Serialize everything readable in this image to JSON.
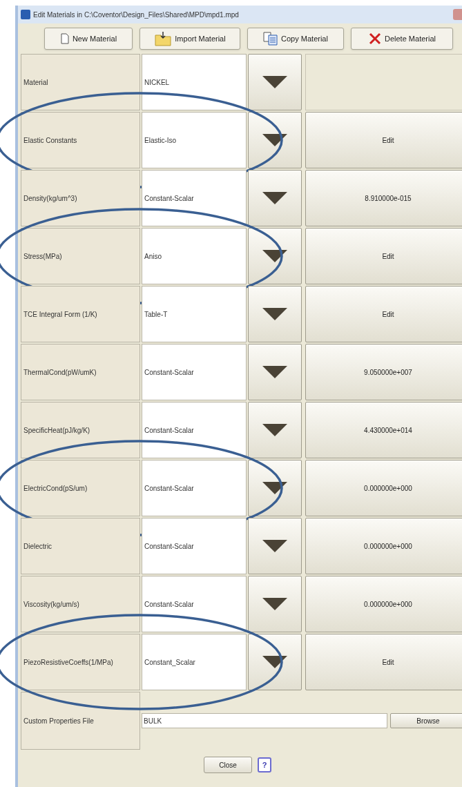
{
  "window": {
    "title": "Edit Materials in C:\\Coventor\\Design_Files\\Shared\\MPD\\mpd1.mpd"
  },
  "toolbar": [
    {
      "label": "New Material",
      "kind": "new"
    },
    {
      "label": "Import Material",
      "kind": "import"
    },
    {
      "label": "Copy Material",
      "kind": "copy"
    },
    {
      "label": "Delete Material",
      "kind": "delete"
    }
  ],
  "properties": [
    {
      "label": "Material",
      "value": "NICKEL",
      "circled": false
    },
    {
      "label": "Elastic Constants",
      "value": "Elastic-Iso",
      "action": "Edit",
      "circled": true
    },
    {
      "label": "Density(kg/um^3)",
      "value": "Constant-Scalar",
      "action": "8.910000e-015",
      "circled": false
    },
    {
      "label": "Stress(MPa)",
      "value": "Aniso",
      "action": "Edit",
      "circled": true
    },
    {
      "label": "TCE Integral Form (1/K)",
      "value": "Table-T",
      "action": "Edit",
      "circled": false
    },
    {
      "label": "ThermalCond(pW/umK)",
      "value": "Constant-Scalar",
      "action": "9.050000e+007",
      "circled": false
    },
    {
      "label": "SpecificHeat(pJ/kg/K)",
      "value": "Constant-Scalar",
      "action": "4.430000e+014",
      "circled": false
    },
    {
      "label": "ElectricCond(pS/um)",
      "value": "Constant-Scalar",
      "action": "0.000000e+000",
      "circled": true
    },
    {
      "label": "Dielectric",
      "value": "Constant-Scalar",
      "action": "0.000000e+000",
      "circled": false
    },
    {
      "label": "Viscosity(kg/um/s)",
      "value": "Constant-Scalar",
      "action": "0.000000e+000",
      "circled": false
    },
    {
      "label": "PiezoResistiveCoeffs(1/MPa)",
      "value": "Constant_Scalar",
      "action": "Edit",
      "circled": true
    }
  ],
  "custom_file": {
    "label": "Custom Properties File",
    "value": "BULK",
    "button": "Browse"
  },
  "footer": {
    "close": "Close",
    "help": "?"
  }
}
